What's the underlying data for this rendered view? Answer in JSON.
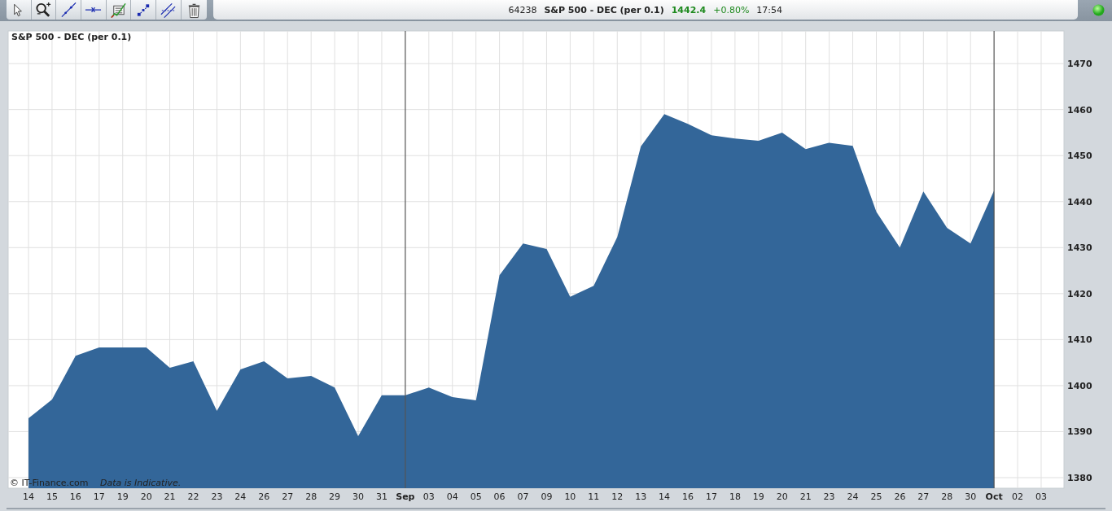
{
  "quote_bar": {
    "code": "64238",
    "instrument": "S&P 500 - DEC (per 0.1)",
    "price": "1442.4",
    "change": "+0.80%",
    "time": "17:54"
  },
  "connection": {
    "on": true
  },
  "chart": {
    "copyright": "© IT-Finance.com",
    "disclaimer": "Data is Indicative.",
    "chart_data": {
      "type": "area",
      "title": "S&P 500 - DEC (per 0.1)",
      "grid": true,
      "categories": [
        "14",
        "15",
        "16",
        "17",
        "19",
        "20",
        "21",
        "22",
        "23",
        "24",
        "26",
        "27",
        "28",
        "29",
        "30",
        "31",
        "Sep",
        "03",
        "04",
        "05",
        "06",
        "07",
        "09",
        "10",
        "11",
        "12",
        "13",
        "14",
        "16",
        "17",
        "18",
        "19",
        "20",
        "21",
        "23",
        "24",
        "25",
        "26",
        "27",
        "28",
        "30",
        "Oct",
        "02",
        "03"
      ],
      "series": [
        {
          "color": "#336699",
          "values": [
            1392.9,
            1397.0,
            1406.5,
            1408.3,
            1408.3,
            1408.3,
            1403.9,
            1405.3,
            1394.5,
            1403.5,
            1405.3,
            1401.6,
            1402.1,
            1399.6,
            1389.0,
            1397.9,
            1397.9,
            1399.6,
            1397.5,
            1396.8,
            1424.0,
            1430.9,
            1429.7,
            1419.3,
            1421.7,
            1432.3,
            1452.0,
            1459.0,
            1456.9,
            1454.4,
            1453.7,
            1453.2,
            1455.0,
            1451.4,
            1452.8,
            1452.1,
            1437.8,
            1430.0,
            1442.2,
            1434.3,
            1430.9,
            1442.4,
            null,
            null
          ]
        }
      ],
      "ylim": [
        1377.7,
        1477.1
      ],
      "yticks": [
        1380,
        1390,
        1400,
        1410,
        1420,
        1430,
        1440,
        1450,
        1460,
        1470
      ]
    }
  }
}
